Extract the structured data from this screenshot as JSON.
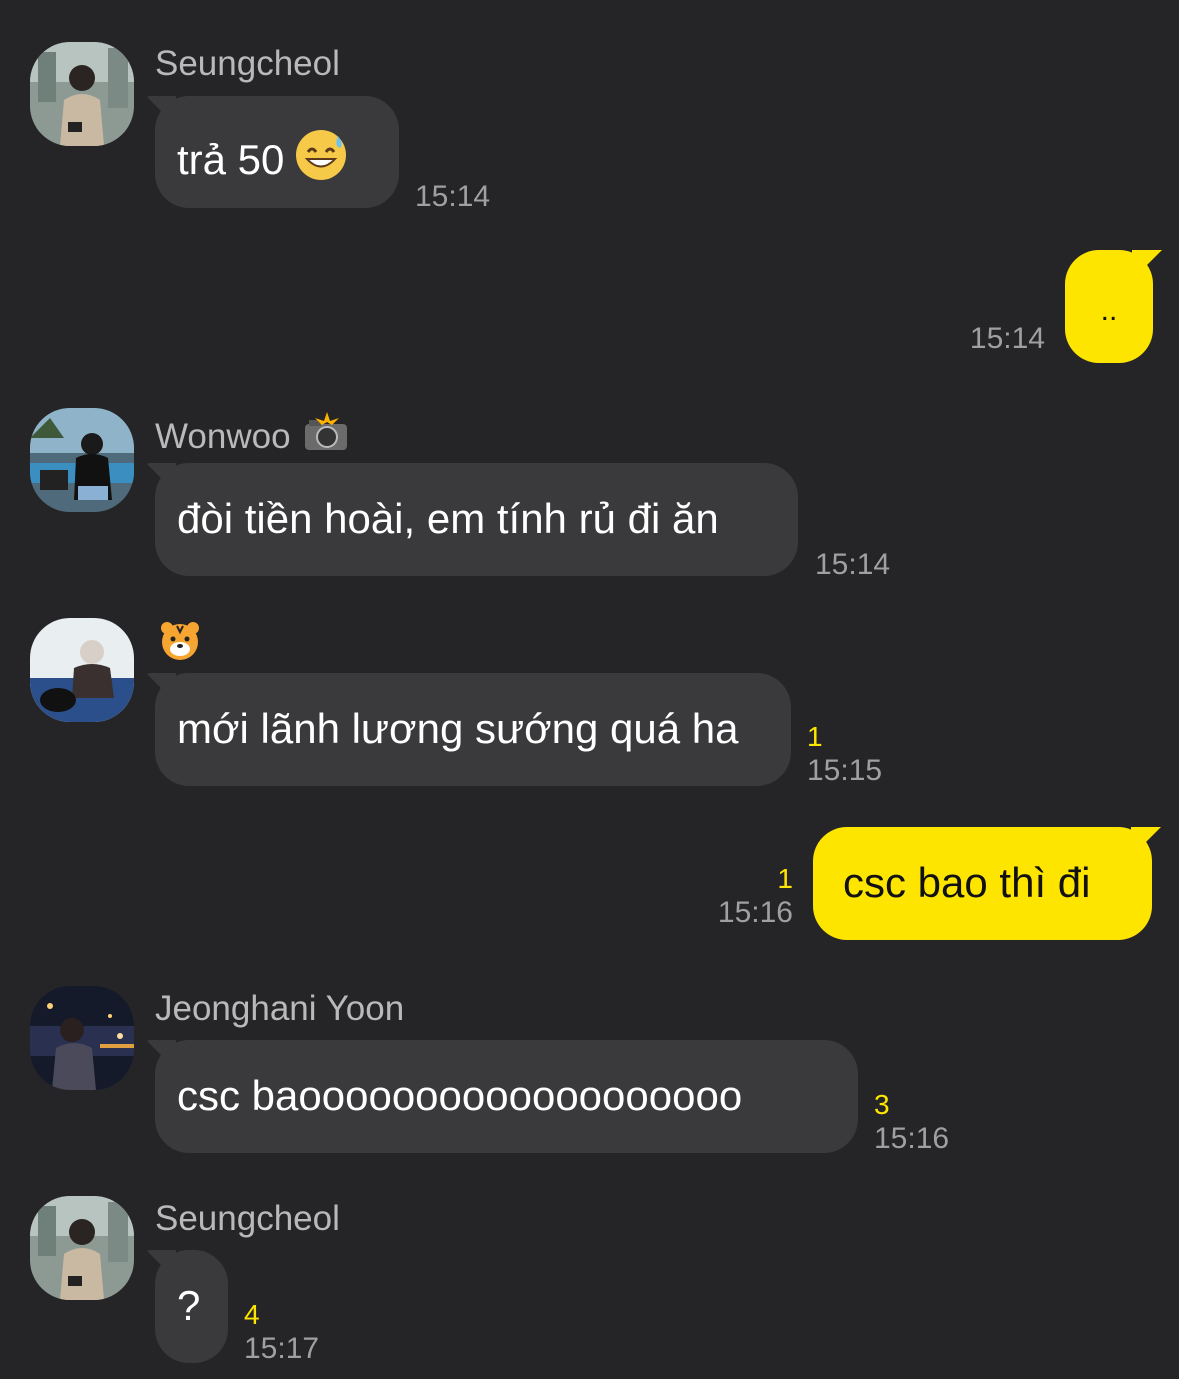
{
  "colors": {
    "background": "#252527",
    "incoming_bubble": "#3a3a3c",
    "outgoing_bubble": "#fee500",
    "unread_count": "#fee500",
    "timestamp": "#a0a0a3",
    "sender_name": "#b9b9bb"
  },
  "messages": [
    {
      "sender": "Seungcheol",
      "text": "trả 50",
      "emoji": "grinning-sweat-emoji",
      "time": "15:14",
      "unread": ""
    },
    {
      "sender": "",
      "text": "..",
      "time": "15:14",
      "unread": "",
      "outgoing": true
    },
    {
      "sender": "Wonwoo",
      "sender_badge": "camera-flash-emoji",
      "text": "đòi tiền hoài, em tính rủ đi ăn",
      "time": "15:14",
      "unread": ""
    },
    {
      "sender": "",
      "sender_badge": "tiger-face-emoji",
      "text": "mới lãnh lương sướng quá ha",
      "time": "15:15",
      "unread": "1"
    },
    {
      "sender": "",
      "text": "csc bao thì đi",
      "time": "15:16",
      "unread": "1",
      "outgoing": true
    },
    {
      "sender": "Jeonghani Yoon",
      "text": "csc baooooooooooooooooooo",
      "time": "15:16",
      "unread": "3"
    },
    {
      "sender": "Seungcheol",
      "text": "?",
      "time": "15:17",
      "unread": "4"
    }
  ]
}
